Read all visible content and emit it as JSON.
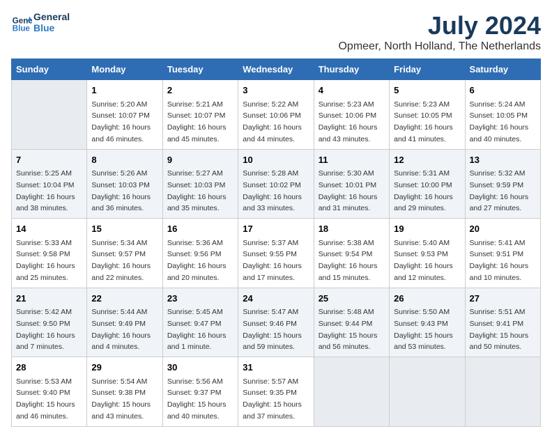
{
  "logo": {
    "line1": "General",
    "line2": "Blue"
  },
  "title": "July 2024",
  "subtitle": "Opmeer, North Holland, The Netherlands",
  "days_of_week": [
    "Sunday",
    "Monday",
    "Tuesday",
    "Wednesday",
    "Thursday",
    "Friday",
    "Saturday"
  ],
  "weeks": [
    [
      {
        "day": "",
        "info": ""
      },
      {
        "day": "1",
        "info": "Sunrise: 5:20 AM\nSunset: 10:07 PM\nDaylight: 16 hours\nand 46 minutes."
      },
      {
        "day": "2",
        "info": "Sunrise: 5:21 AM\nSunset: 10:07 PM\nDaylight: 16 hours\nand 45 minutes."
      },
      {
        "day": "3",
        "info": "Sunrise: 5:22 AM\nSunset: 10:06 PM\nDaylight: 16 hours\nand 44 minutes."
      },
      {
        "day": "4",
        "info": "Sunrise: 5:23 AM\nSunset: 10:06 PM\nDaylight: 16 hours\nand 43 minutes."
      },
      {
        "day": "5",
        "info": "Sunrise: 5:23 AM\nSunset: 10:05 PM\nDaylight: 16 hours\nand 41 minutes."
      },
      {
        "day": "6",
        "info": "Sunrise: 5:24 AM\nSunset: 10:05 PM\nDaylight: 16 hours\nand 40 minutes."
      }
    ],
    [
      {
        "day": "7",
        "info": "Sunrise: 5:25 AM\nSunset: 10:04 PM\nDaylight: 16 hours\nand 38 minutes."
      },
      {
        "day": "8",
        "info": "Sunrise: 5:26 AM\nSunset: 10:03 PM\nDaylight: 16 hours\nand 36 minutes."
      },
      {
        "day": "9",
        "info": "Sunrise: 5:27 AM\nSunset: 10:03 PM\nDaylight: 16 hours\nand 35 minutes."
      },
      {
        "day": "10",
        "info": "Sunrise: 5:28 AM\nSunset: 10:02 PM\nDaylight: 16 hours\nand 33 minutes."
      },
      {
        "day": "11",
        "info": "Sunrise: 5:30 AM\nSunset: 10:01 PM\nDaylight: 16 hours\nand 31 minutes."
      },
      {
        "day": "12",
        "info": "Sunrise: 5:31 AM\nSunset: 10:00 PM\nDaylight: 16 hours\nand 29 minutes."
      },
      {
        "day": "13",
        "info": "Sunrise: 5:32 AM\nSunset: 9:59 PM\nDaylight: 16 hours\nand 27 minutes."
      }
    ],
    [
      {
        "day": "14",
        "info": "Sunrise: 5:33 AM\nSunset: 9:58 PM\nDaylight: 16 hours\nand 25 minutes."
      },
      {
        "day": "15",
        "info": "Sunrise: 5:34 AM\nSunset: 9:57 PM\nDaylight: 16 hours\nand 22 minutes."
      },
      {
        "day": "16",
        "info": "Sunrise: 5:36 AM\nSunset: 9:56 PM\nDaylight: 16 hours\nand 20 minutes."
      },
      {
        "day": "17",
        "info": "Sunrise: 5:37 AM\nSunset: 9:55 PM\nDaylight: 16 hours\nand 17 minutes."
      },
      {
        "day": "18",
        "info": "Sunrise: 5:38 AM\nSunset: 9:54 PM\nDaylight: 16 hours\nand 15 minutes."
      },
      {
        "day": "19",
        "info": "Sunrise: 5:40 AM\nSunset: 9:53 PM\nDaylight: 16 hours\nand 12 minutes."
      },
      {
        "day": "20",
        "info": "Sunrise: 5:41 AM\nSunset: 9:51 PM\nDaylight: 16 hours\nand 10 minutes."
      }
    ],
    [
      {
        "day": "21",
        "info": "Sunrise: 5:42 AM\nSunset: 9:50 PM\nDaylight: 16 hours\nand 7 minutes."
      },
      {
        "day": "22",
        "info": "Sunrise: 5:44 AM\nSunset: 9:49 PM\nDaylight: 16 hours\nand 4 minutes."
      },
      {
        "day": "23",
        "info": "Sunrise: 5:45 AM\nSunset: 9:47 PM\nDaylight: 16 hours\nand 1 minute."
      },
      {
        "day": "24",
        "info": "Sunrise: 5:47 AM\nSunset: 9:46 PM\nDaylight: 15 hours\nand 59 minutes."
      },
      {
        "day": "25",
        "info": "Sunrise: 5:48 AM\nSunset: 9:44 PM\nDaylight: 15 hours\nand 56 minutes."
      },
      {
        "day": "26",
        "info": "Sunrise: 5:50 AM\nSunset: 9:43 PM\nDaylight: 15 hours\nand 53 minutes."
      },
      {
        "day": "27",
        "info": "Sunrise: 5:51 AM\nSunset: 9:41 PM\nDaylight: 15 hours\nand 50 minutes."
      }
    ],
    [
      {
        "day": "28",
        "info": "Sunrise: 5:53 AM\nSunset: 9:40 PM\nDaylight: 15 hours\nand 46 minutes."
      },
      {
        "day": "29",
        "info": "Sunrise: 5:54 AM\nSunset: 9:38 PM\nDaylight: 15 hours\nand 43 minutes."
      },
      {
        "day": "30",
        "info": "Sunrise: 5:56 AM\nSunset: 9:37 PM\nDaylight: 15 hours\nand 40 minutes."
      },
      {
        "day": "31",
        "info": "Sunrise: 5:57 AM\nSunset: 9:35 PM\nDaylight: 15 hours\nand 37 minutes."
      },
      {
        "day": "",
        "info": ""
      },
      {
        "day": "",
        "info": ""
      },
      {
        "day": "",
        "info": ""
      }
    ]
  ]
}
